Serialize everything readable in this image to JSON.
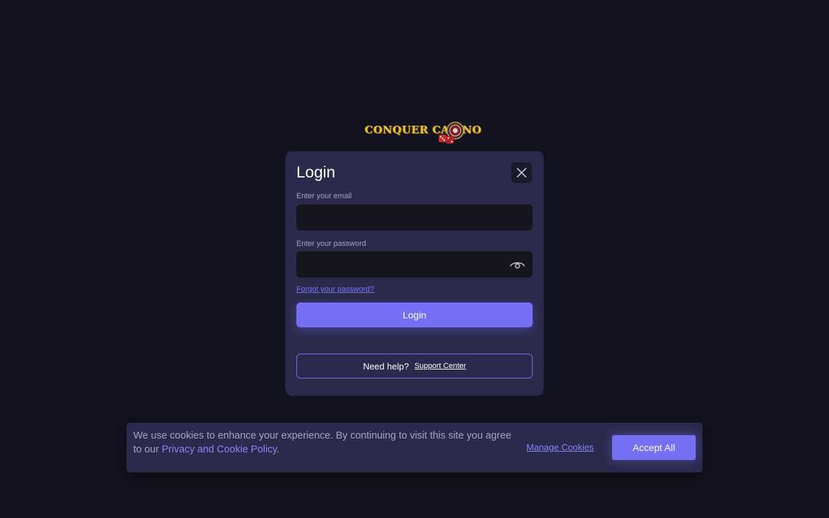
{
  "logo": {
    "text": "CONQUER CASINO"
  },
  "login_modal": {
    "title": "Login",
    "close_icon": "close-icon",
    "email_label": "Enter your email",
    "email_value": "",
    "password_label": "Enter your password",
    "password_value": "",
    "password_toggle_icon": "eye-icon",
    "forgot_password": "Forgot your password?",
    "login_button": "Login",
    "help_text": "Need help?",
    "support_link": "Support Center"
  },
  "cookie_banner": {
    "text_before_link": "We use cookies to enhance your experience. By continuing to visit this site you agree to our ",
    "policy_link": "Privacy and Cookie Policy",
    "text_after_link": ".",
    "manage_cookies": "Manage Cookies",
    "accept_all": "Accept All"
  },
  "colors": {
    "page_background": "#13131f",
    "panel_background": "#2b2a4c",
    "input_background": "#17161f",
    "accent": "#7570f3",
    "link": "#8a86f7",
    "muted_text": "#a6a4c6",
    "logo_gold": "#e9c443"
  }
}
